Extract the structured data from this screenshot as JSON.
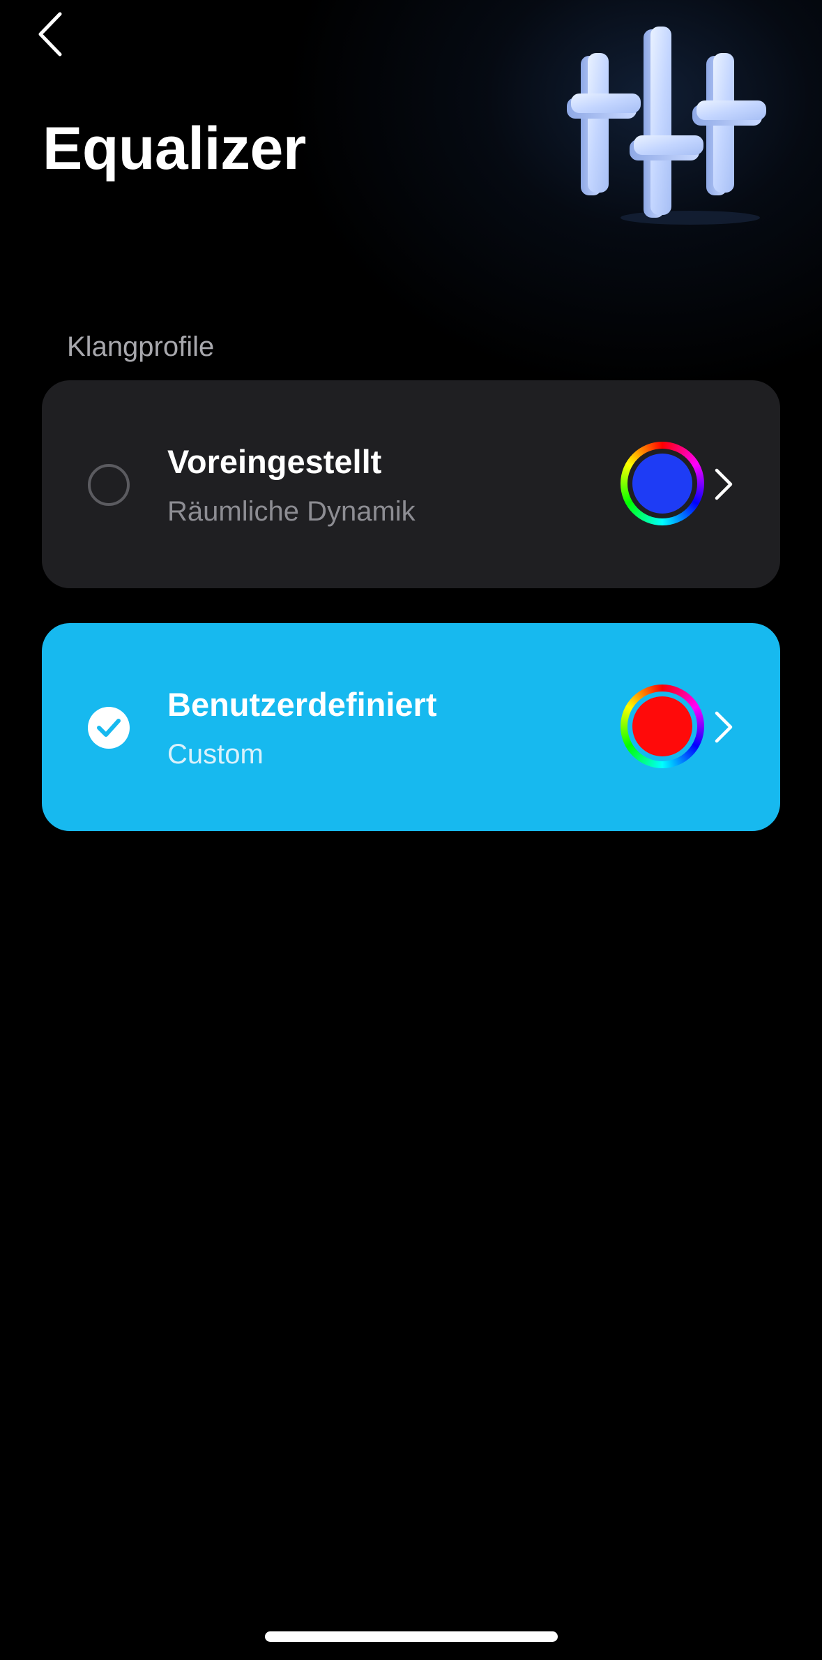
{
  "header": {
    "title": "Equalizer",
    "back_icon": "chevron-left-icon",
    "hero_icon": "equalizer-sliders-icon"
  },
  "section": {
    "label": "Klangprofile"
  },
  "profiles": [
    {
      "title": "Voreingestellt",
      "subtitle": "Räumliche Dynamik",
      "selected": false,
      "color": "#1e3cf5"
    },
    {
      "title": "Benutzerdefiniert",
      "subtitle": "Custom",
      "selected": true,
      "color": "#ff0a0a"
    }
  ],
  "colors": {
    "background": "#000000",
    "card_default": "#1f1f22",
    "card_selected": "#17b9ef",
    "text_primary": "#ffffff",
    "text_secondary": "#8d8d93"
  }
}
